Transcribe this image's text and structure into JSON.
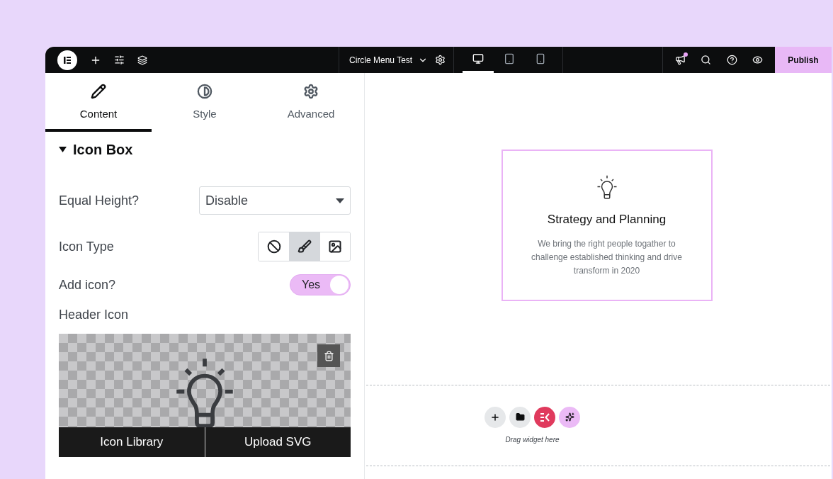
{
  "top_bar": {
    "document_title": "Circle Menu Test",
    "devices": [
      {
        "kind": "desktop",
        "selected": true
      },
      {
        "kind": "tablet",
        "selected": false
      },
      {
        "kind": "mobile",
        "selected": false
      }
    ],
    "notification_dot": true,
    "publish_button": "Publish"
  },
  "panel_tabs": [
    {
      "kind": "content",
      "label": "Content",
      "selected": true
    },
    {
      "kind": "style",
      "label": "Style",
      "selected": false
    },
    {
      "kind": "advanced",
      "label": "Advanced",
      "selected": false
    }
  ],
  "section": {
    "title": "Icon Box",
    "expanded": true
  },
  "controls": [
    {
      "kind": "select",
      "label": "Equal Height?",
      "value": "Disable"
    },
    {
      "kind": "choose",
      "label": "Icon Type",
      "options": [
        {
          "kind": "none",
          "selected": false
        },
        {
          "kind": "icon",
          "selected": true
        },
        {
          "kind": "image",
          "selected": false
        }
      ]
    },
    {
      "kind": "switch",
      "label": "Add icon?",
      "on": true,
      "on_text": "Yes"
    }
  ],
  "header_icon": {
    "label": "Header Icon",
    "buttons": [
      "Icon Library",
      "Upload SVG"
    ]
  },
  "canvas": {
    "card": {
      "title": "Strategy and Planning",
      "text": "We bring the right people togather to challenge established thinking and drive transform in 2020"
    },
    "drop_zone": {
      "hint": "Drag widget here"
    }
  }
}
